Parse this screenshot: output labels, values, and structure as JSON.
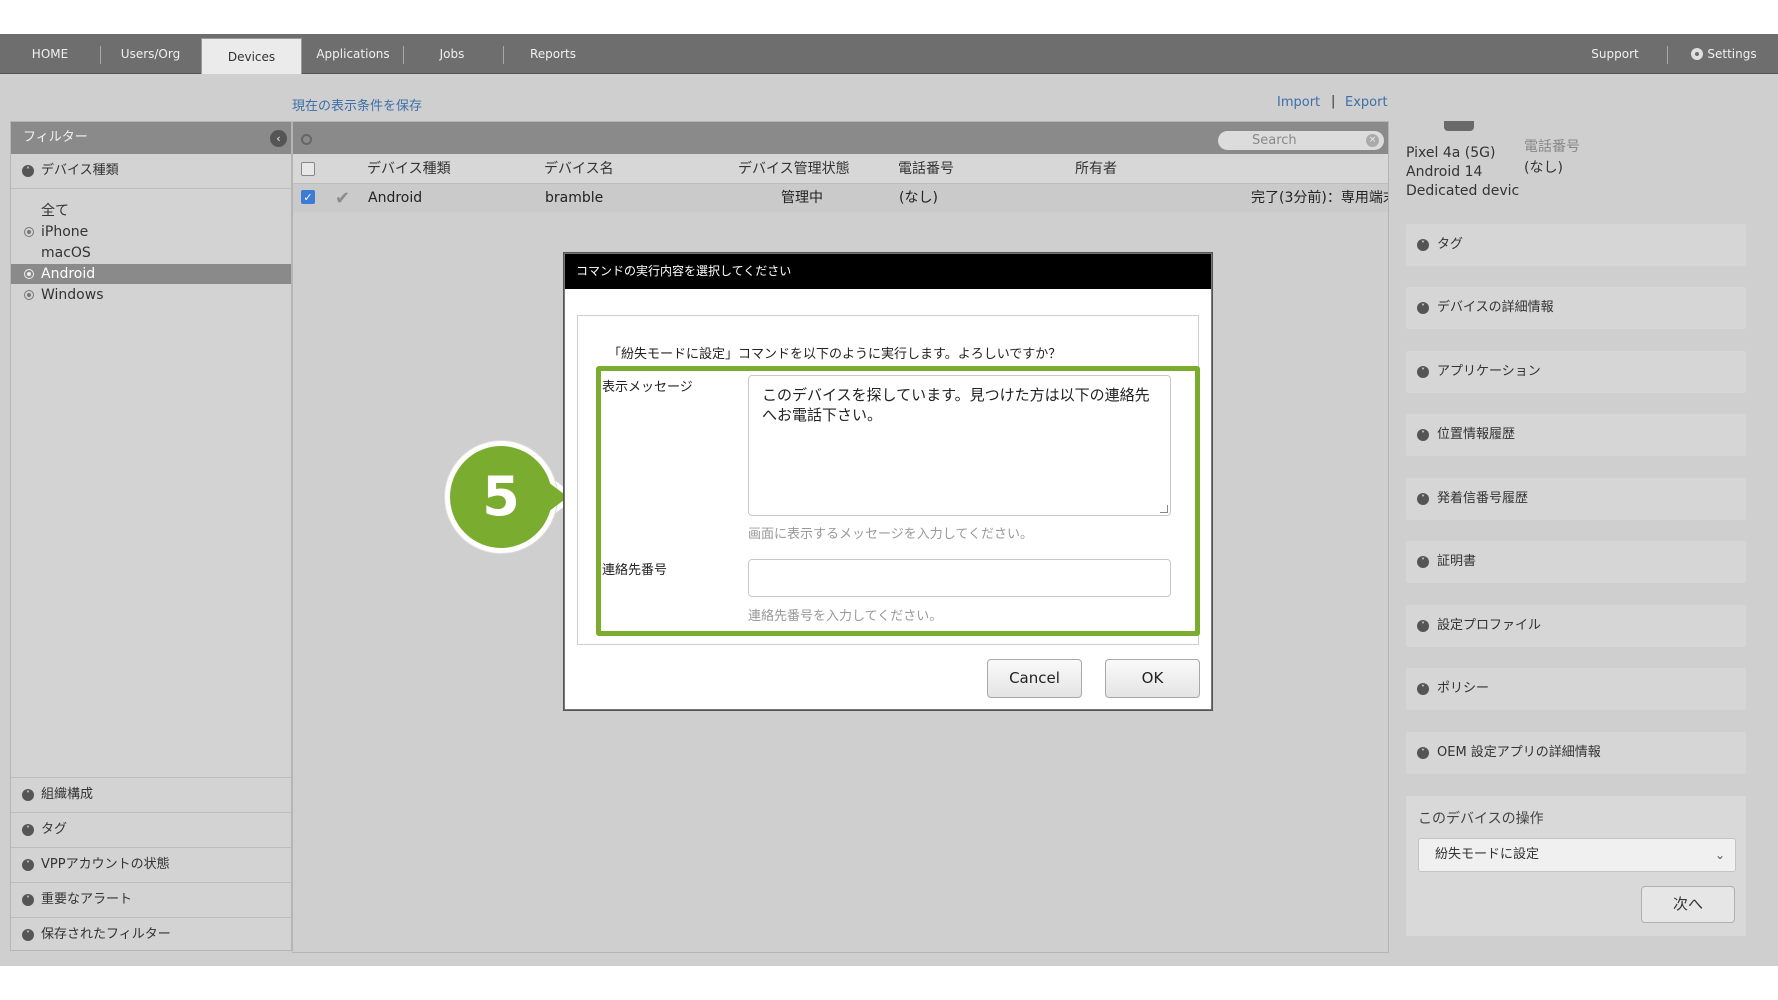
{
  "nav": {
    "home": "HOME",
    "users": "Users/Org",
    "devices": "Devices",
    "applications": "Applications",
    "jobs": "Jobs",
    "reports": "Reports",
    "support": "Support",
    "settings": "Settings"
  },
  "toolbar": {
    "save_view": "現在の表示条件を保存",
    "import": "Import",
    "separator": "|",
    "export": "Export"
  },
  "filter": {
    "title": "フィルター",
    "collapse_icon": "chevron-left-icon",
    "device_type_header": "デバイス種類",
    "device_types": [
      "全て",
      "iPhone",
      "macOS",
      "Android",
      "Windows"
    ],
    "selected_type": "Android",
    "bottom_sections": [
      "組織構成",
      "タグ",
      "VPPアカウントの状態",
      "重要なアラート",
      "保存されたフィルター"
    ]
  },
  "search": {
    "placeholder": "Search"
  },
  "table": {
    "headers": [
      "デバイス種類",
      "デバイス名",
      "デバイス管理状態",
      "電話番号",
      "所有者"
    ],
    "rows": [
      {
        "type": "Android",
        "name": "bramble",
        "state": "管理中",
        "phone": "(なし)",
        "owner": "",
        "last_job": "完了(3分前)：専用端末"
      }
    ]
  },
  "right_panel": {
    "model": "Pixel 4a (5G)",
    "os": "Android 14",
    "mode": "Dedicated devic",
    "phone_label": "電話番号",
    "phone_value": "(なし)",
    "sections": [
      "タグ",
      "デバイスの詳細情報",
      "アプリケーション",
      "位置情報履歴",
      "発着信番号履歴",
      "証明書",
      "設定プロファイル",
      "ポリシー",
      "OEM 設定アプリの詳細情報"
    ],
    "ops_title": "このデバイスの操作",
    "ops_selected": "紛失モードに設定",
    "next_label": "次へ"
  },
  "modal": {
    "title": "コマンドの実行内容を選択してください",
    "question": "「紛失モードに設定」コマンドを以下のように実行します。よろしいですか？",
    "message_label": "表示メッセージ",
    "message_value": "このデバイスを探しています。見つけた方は以下の連絡先へお電話下さい。",
    "message_hint": "画面に表示するメッセージを入力してください。",
    "contact_label": "連絡先番号",
    "contact_value": "",
    "contact_hint": "連絡先番号を入力してください。",
    "cancel": "Cancel",
    "ok": "OK"
  },
  "callout": {
    "step": "5"
  },
  "colors": {
    "nav_bg": "#6e6e6e",
    "highlight": "#7aac2f",
    "link": "#3d6fa8",
    "checkbox_checked": "#3c7bd6"
  }
}
